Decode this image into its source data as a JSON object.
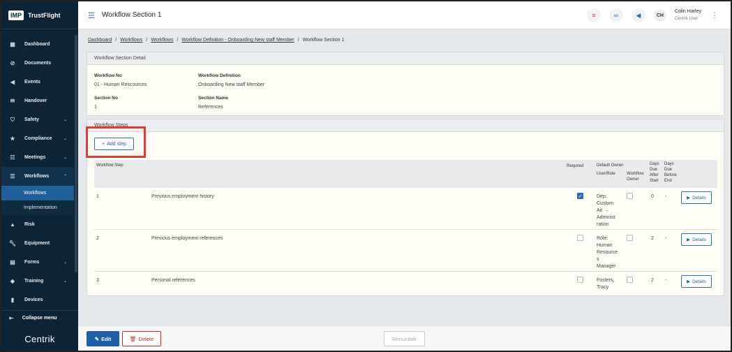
{
  "brand": {
    "logo": "IMP",
    "name": "TrustFlight",
    "footer_logo": "Centrik"
  },
  "sidebar": {
    "items": [
      {
        "label": "Dashboard",
        "icon": "grid-icon"
      },
      {
        "label": "Documents",
        "icon": "paperclip-icon"
      },
      {
        "label": "Events",
        "icon": "megaphone-icon"
      },
      {
        "label": "Handover",
        "icon": "envelope-icon"
      },
      {
        "label": "Safety",
        "icon": "shield-icon"
      },
      {
        "label": "Compliance",
        "icon": "award-icon"
      },
      {
        "label": "Meetings",
        "icon": "people-icon"
      },
      {
        "label": "Workflows",
        "icon": "workflow-icon"
      },
      {
        "label": "Workflows"
      },
      {
        "label": "Implementation"
      },
      {
        "label": "Risk",
        "icon": "risk-icon"
      },
      {
        "label": "Equipment",
        "icon": "wrench-icon"
      },
      {
        "label": "Forms",
        "icon": "forms-icon"
      },
      {
        "label": "Training",
        "icon": "graduation-icon"
      },
      {
        "label": "Devices",
        "icon": "devices-icon"
      }
    ],
    "collapse_label": "Collapse menu"
  },
  "header": {
    "title": "Workflow Section 1",
    "user_initials": "CH",
    "user_name": "Colin Harley",
    "user_role": "Centrik User"
  },
  "breadcrumb": {
    "items": [
      "Dashboard",
      "Workflows",
      "Workflows",
      "Workflow Definition - Onboarding New staff Member"
    ],
    "current": "Workflow Section 1",
    "sep": "/"
  },
  "detail": {
    "header": "Workflow Section Detail",
    "workflow_no_label": "Workflow No",
    "workflow_no": "01 - Human Rescources",
    "definition_label": "Workflow Definition",
    "definition": "Onboarding New staff Member",
    "section_no_label": "Section No",
    "section_no": "1",
    "section_name_label": "Section Name",
    "section_name": "References"
  },
  "steps": {
    "header": "Workflow Steps",
    "add_label": "Add step",
    "columns": {
      "step": "Workflow Step",
      "required": "Required",
      "default_owner": "Default Owner",
      "user_role": "User/Role",
      "workflow_owner_1": "Workflow",
      "workflow_owner_2": "Owner",
      "days_after_1": "Days",
      "days_after_2": "Due",
      "days_after_3": "After",
      "days_after_4": "Start",
      "days_before_1": "Days",
      "days_before_2": "Due",
      "days_before_3": "Before",
      "days_before_4": "End"
    },
    "rows": [
      {
        "no": "1",
        "name": "Previous employment history",
        "required": true,
        "owner_lines": [
          "Dep:",
          "Custom",
          "Air →",
          "Administ",
          "ration"
        ],
        "after": "0",
        "before": "-"
      },
      {
        "no": "2",
        "name": "Previous employment references",
        "required": false,
        "owner_lines": [
          "Role:",
          "Human",
          "Resource",
          "s",
          "Manager"
        ],
        "after": "2",
        "before": "-"
      },
      {
        "no": "3",
        "name": "Personal references",
        "required": false,
        "owner_lines": [
          "Fosters,",
          "Tracy",
          "",
          "",
          ""
        ],
        "after": "2",
        "before": "-"
      }
    ],
    "details_label": "Details"
  },
  "footer": {
    "edit_label": "Edit",
    "delete_label": "Delete",
    "renumber_label": "Renumber"
  }
}
